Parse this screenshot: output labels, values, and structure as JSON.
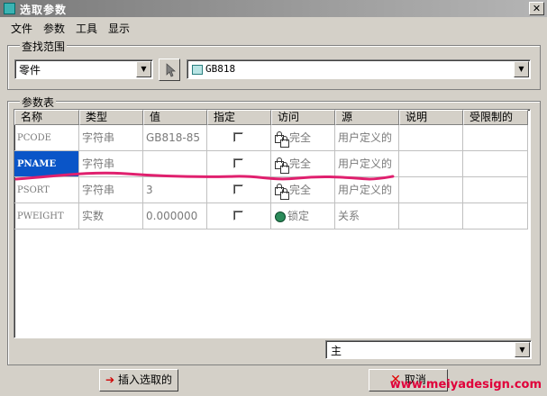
{
  "window": {
    "title": "选取参数",
    "close_glyph": "✕"
  },
  "menu": [
    "文件",
    "参数",
    "工具",
    "显示"
  ],
  "search_group": {
    "label": "查找范围",
    "scope_value": "零件",
    "target_value": "GB818"
  },
  "table_group": {
    "label": "参数表",
    "columns": [
      "名称",
      "类型",
      "值",
      "指定",
      "访问",
      "源",
      "说明",
      "受限制的"
    ],
    "rows": [
      {
        "name": "PCODE",
        "type": "字符串",
        "value": "GB818-85",
        "checked": false,
        "access": "完全",
        "access_icon": "lock-pair-icon",
        "source": "用户定义的",
        "selected": false
      },
      {
        "name": "PNAME",
        "type": "字符串",
        "value": "",
        "checked": false,
        "access": "完全",
        "access_icon": "lock-pair-icon",
        "source": "用户定义的",
        "selected": true
      },
      {
        "name": "PSORT",
        "type": "字符串",
        "value": "3",
        "checked": false,
        "access": "完全",
        "access_icon": "lock-pair-icon",
        "source": "用户定义的",
        "selected": false
      },
      {
        "name": "PWEIGHT",
        "type": "实数",
        "value": "0.000000",
        "checked": false,
        "access": "锁定",
        "access_icon": "locked-icon",
        "source": "关系",
        "selected": false
      }
    ]
  },
  "filter_value": "主",
  "buttons": {
    "insert": "插入选取的",
    "cancel": "取消"
  },
  "watermark": "www.meiyadesign.com",
  "colors": {
    "selection": "#0a55c8",
    "annotation": "#e0206e",
    "watermark": "#e0003a"
  }
}
